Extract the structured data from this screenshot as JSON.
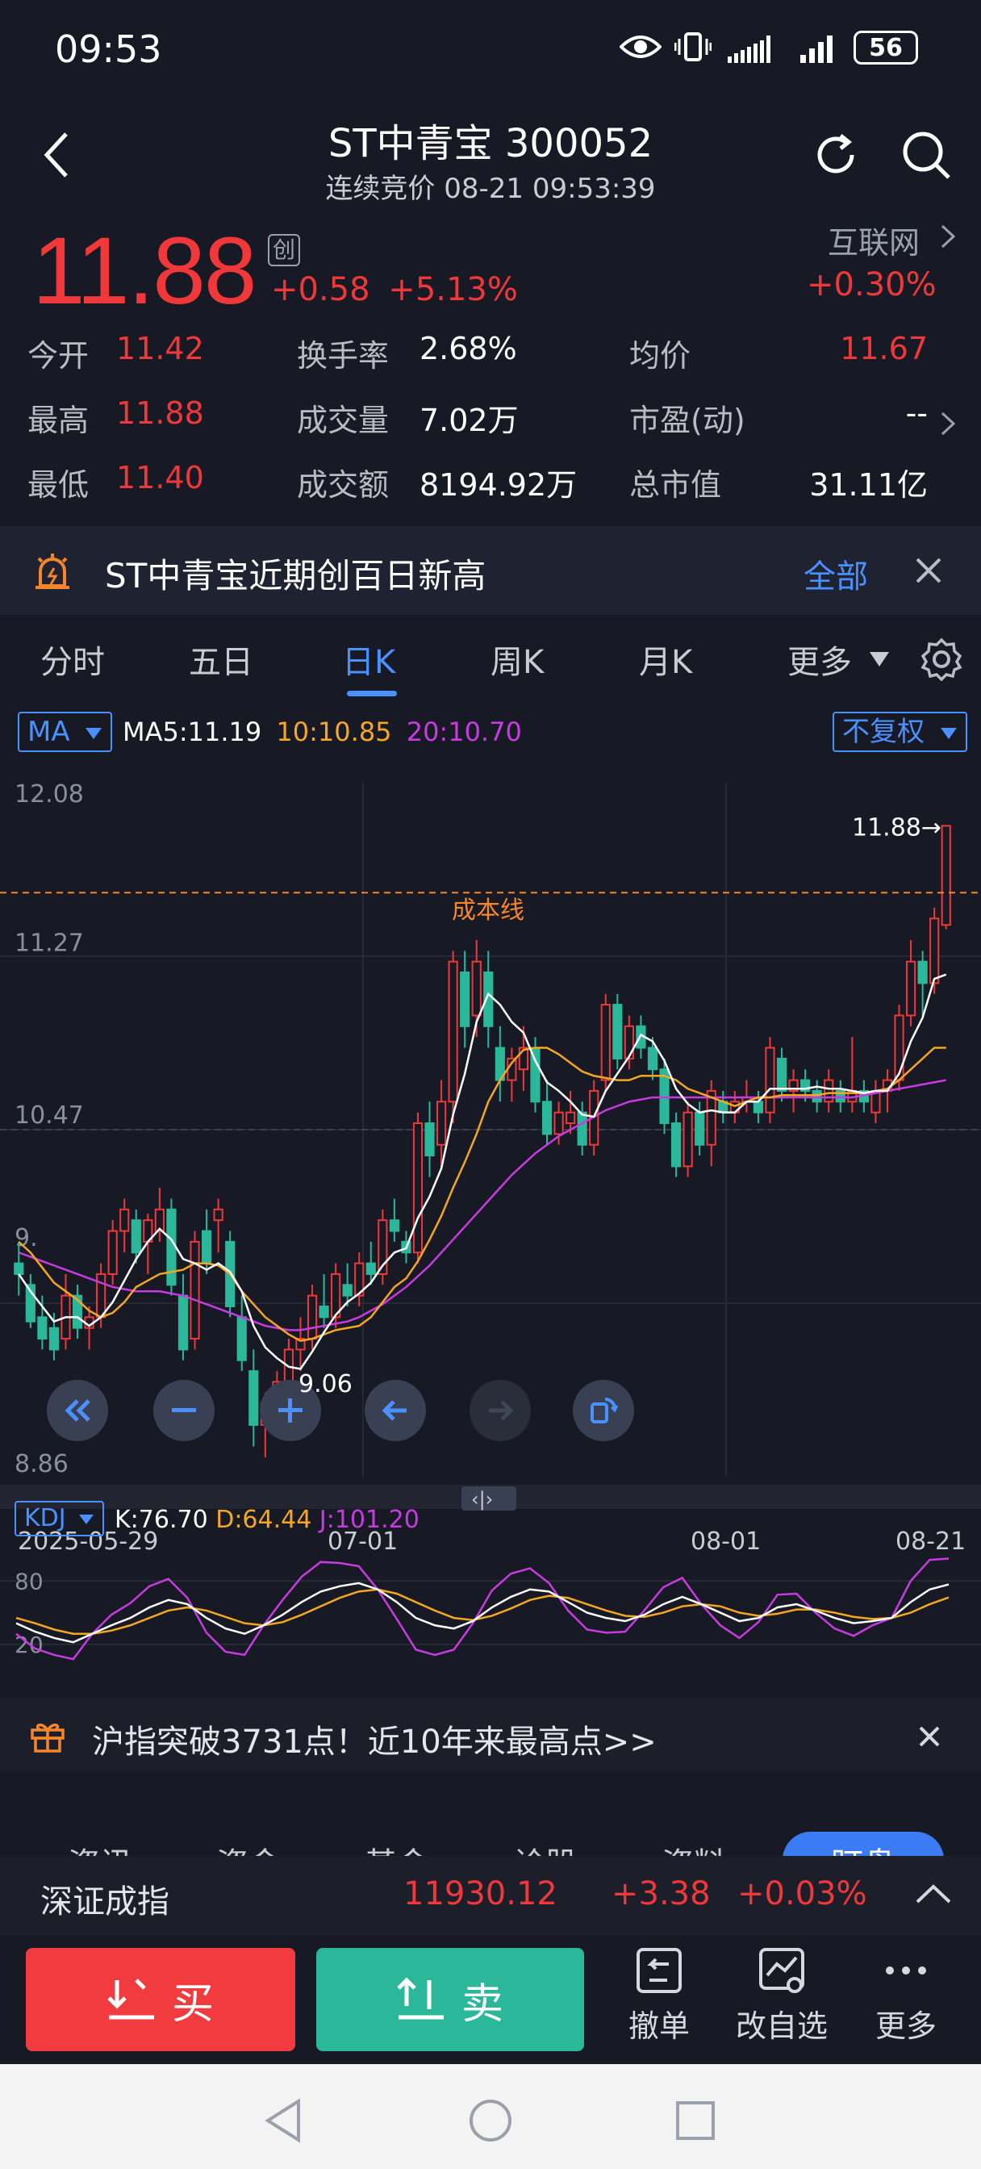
{
  "status": {
    "time": "09:53",
    "battery": "56"
  },
  "header": {
    "title": "ST中青宝 300052",
    "subtitle": "连续竞价 08-21 09:53:39"
  },
  "quote": {
    "price": "11.88",
    "board_badge": "创",
    "change": "+0.58",
    "change_pct": "+5.13%",
    "sector_name": "互联网",
    "sector_pct": "+0.30%",
    "stats": [
      {
        "label": "今开",
        "value": "11.42",
        "color": "red"
      },
      {
        "label": "换手率",
        "value": "2.68%",
        "color": "white"
      },
      {
        "label": "均价",
        "value": "11.67",
        "color": "red"
      },
      {
        "label": "最高",
        "value": "11.88",
        "color": "red"
      },
      {
        "label": "成交量",
        "value": "7.02万",
        "color": "white"
      },
      {
        "label": "市盈(动)",
        "value": "--",
        "color": "white"
      },
      {
        "label": "最低",
        "value": "11.40",
        "color": "red"
      },
      {
        "label": "成交额",
        "value": "8194.92万",
        "color": "white"
      },
      {
        "label": "总市值",
        "value": "31.11亿",
        "color": "white"
      }
    ]
  },
  "alert_banner": {
    "text": "ST中青宝近期创百日新高",
    "action": "全部"
  },
  "tabs": [
    {
      "label": "分时"
    },
    {
      "label": "五日"
    },
    {
      "label": "日K",
      "active": true
    },
    {
      "label": "周K"
    },
    {
      "label": "月K"
    },
    {
      "label": "更多"
    }
  ],
  "kline": {
    "indicator": "MA",
    "ma5": "MA5:11.19",
    "ma10": "10:10.85",
    "ma20": "20:10.70",
    "adjust": "不复权",
    "y_labels": [
      "12.08",
      "11.27",
      "10.47",
      "9.",
      "8.86"
    ],
    "cost_line_label": "成本线",
    "last_price_label": "11.88",
    "low_label": "9.06",
    "x_labels": [
      "2025-05-29",
      "07-01",
      "08-01",
      "08-21"
    ],
    "colors": {
      "up": "#f0383a",
      "down": "#2bb79a",
      "ma5": "#ffffff",
      "ma10": "#f5a623",
      "ma20": "#c73be0",
      "cost": "#f5862c"
    }
  },
  "kdj": {
    "indicator": "KDJ",
    "k": "K:76.70",
    "d": "D:64.44",
    "j": "J:101.20",
    "y_labels": [
      "80",
      "20"
    ]
  },
  "promo_banner": {
    "text": "沪指突破3731点！近10年来最高点>>"
  },
  "hidden_tabs": [
    "资讯",
    "资金",
    "基金",
    "诊股",
    "资料",
    "盯盘"
  ],
  "index": {
    "name": "深证成指",
    "value": "11930.12",
    "change": "+3.38",
    "pct": "+0.03%"
  },
  "actions": {
    "buy": "买",
    "sell": "卖",
    "cancel": "撤单",
    "edit_watch": "改自选",
    "more": "更多"
  },
  "chart_data": [
    {
      "type": "candlestick",
      "title": "",
      "x_labels": [
        "2025-05-29",
        "07-01",
        "08-01",
        "08-21"
      ],
      "ylim": [
        8.86,
        12.08
      ],
      "y_ticks": [
        12.08,
        11.27,
        10.47,
        8.86
      ],
      "candles": [
        [
          9.85,
          9.95,
          9.7,
          9.8
        ],
        [
          9.75,
          9.8,
          9.55,
          9.58
        ],
        [
          9.6,
          9.7,
          9.45,
          9.5
        ],
        [
          9.55,
          9.62,
          9.4,
          9.45
        ],
        [
          9.5,
          9.8,
          9.45,
          9.7
        ],
        [
          9.7,
          9.75,
          9.5,
          9.55
        ],
        [
          9.55,
          9.65,
          9.45,
          9.6
        ],
        [
          9.6,
          9.85,
          9.55,
          9.8
        ],
        [
          9.8,
          10.05,
          9.75,
          10.0
        ],
        [
          10.0,
          10.15,
          9.9,
          10.1
        ],
        [
          10.05,
          10.1,
          9.85,
          9.9
        ],
        [
          9.95,
          10.08,
          9.8,
          10.05
        ],
        [
          10.0,
          10.2,
          9.95,
          10.1
        ],
        [
          10.1,
          10.15,
          9.7,
          9.75
        ],
        [
          9.7,
          9.8,
          9.4,
          9.45
        ],
        [
          9.5,
          10.0,
          9.45,
          9.95
        ],
        [
          10.0,
          10.1,
          9.8,
          9.85
        ],
        [
          10.05,
          10.15,
          9.9,
          10.1
        ],
        [
          9.95,
          10.0,
          9.6,
          9.65
        ],
        [
          9.6,
          9.7,
          9.35,
          9.4
        ],
        [
          9.35,
          9.45,
          9.0,
          9.1
        ],
        [
          9.1,
          9.25,
          8.95,
          9.2
        ],
        [
          9.2,
          9.35,
          9.1,
          9.3
        ],
        [
          9.3,
          9.5,
          9.2,
          9.45
        ],
        [
          9.45,
          9.6,
          9.35,
          9.5
        ],
        [
          9.5,
          9.75,
          9.45,
          9.7
        ],
        [
          9.65,
          9.8,
          9.55,
          9.6
        ],
        [
          9.6,
          9.85,
          9.55,
          9.8
        ],
        [
          9.75,
          9.85,
          9.65,
          9.7
        ],
        [
          9.7,
          9.9,
          9.65,
          9.85
        ],
        [
          9.85,
          9.95,
          9.75,
          9.8
        ],
        [
          9.8,
          10.1,
          9.75,
          10.05
        ],
        [
          10.05,
          10.15,
          9.95,
          10.0
        ],
        [
          9.95,
          10.0,
          9.85,
          9.9
        ],
        [
          9.9,
          10.55,
          9.85,
          10.5
        ],
        [
          10.5,
          10.6,
          10.25,
          10.35
        ],
        [
          10.4,
          10.7,
          10.3,
          10.6
        ],
        [
          10.6,
          11.3,
          10.5,
          11.25
        ],
        [
          11.2,
          11.3,
          10.85,
          10.95
        ],
        [
          11.0,
          11.35,
          10.9,
          11.25
        ],
        [
          11.2,
          11.3,
          10.85,
          10.95
        ],
        [
          10.85,
          10.95,
          10.6,
          10.7
        ],
        [
          10.7,
          10.85,
          10.6,
          10.8
        ],
        [
          10.75,
          10.95,
          10.65,
          10.85
        ],
        [
          10.85,
          10.9,
          10.55,
          10.6
        ],
        [
          10.6,
          10.7,
          10.4,
          10.45
        ],
        [
          10.45,
          10.6,
          10.4,
          10.55
        ],
        [
          10.5,
          10.65,
          10.45,
          10.55
        ],
        [
          10.55,
          10.6,
          10.35,
          10.4
        ],
        [
          10.4,
          10.7,
          10.35,
          10.65
        ],
        [
          10.7,
          11.1,
          10.65,
          11.05
        ],
        [
          11.05,
          11.1,
          10.75,
          10.8
        ],
        [
          10.8,
          11.0,
          10.75,
          10.95
        ],
        [
          10.95,
          11.0,
          10.8,
          10.85
        ],
        [
          10.85,
          10.9,
          10.7,
          10.75
        ],
        [
          10.75,
          10.8,
          10.45,
          10.5
        ],
        [
          10.5,
          10.55,
          10.25,
          10.3
        ],
        [
          10.3,
          10.6,
          10.25,
          10.55
        ],
        [
          10.55,
          10.6,
          10.35,
          10.4
        ],
        [
          10.4,
          10.7,
          10.3,
          10.65
        ],
        [
          10.6,
          10.65,
          10.5,
          10.55
        ],
        [
          10.55,
          10.65,
          10.5,
          10.6
        ],
        [
          10.6,
          10.7,
          10.55,
          10.62
        ],
        [
          10.6,
          10.65,
          10.5,
          10.55
        ],
        [
          10.55,
          10.9,
          10.5,
          10.85
        ],
        [
          10.8,
          10.85,
          10.6,
          10.65
        ],
        [
          10.65,
          10.75,
          10.55,
          10.7
        ],
        [
          10.7,
          10.75,
          10.6,
          10.65
        ],
        [
          10.65,
          10.7,
          10.55,
          10.6
        ],
        [
          10.6,
          10.75,
          10.55,
          10.7
        ],
        [
          10.65,
          10.7,
          10.55,
          10.6
        ],
        [
          10.6,
          10.9,
          10.55,
          10.65
        ],
        [
          10.65,
          10.7,
          10.55,
          10.6
        ],
        [
          10.55,
          10.7,
          10.5,
          10.65
        ],
        [
          10.65,
          10.75,
          10.55,
          10.7
        ],
        [
          10.7,
          11.05,
          10.65,
          11.0
        ],
        [
          11.0,
          11.35,
          10.95,
          11.25
        ],
        [
          11.25,
          11.3,
          11.0,
          11.15
        ],
        [
          11.15,
          11.5,
          11.1,
          11.45
        ],
        [
          11.42,
          11.88,
          11.4,
          11.88
        ]
      ],
      "ma5_series": [
        9.8,
        9.72,
        9.65,
        9.58,
        9.6,
        9.6,
        9.56,
        9.6,
        9.67,
        9.77,
        9.87,
        9.95,
        10.01,
        9.96,
        9.87,
        9.85,
        9.82,
        9.85,
        9.81,
        9.72,
        9.56,
        9.46,
        9.41,
        9.37,
        9.36,
        9.44,
        9.53,
        9.61,
        9.67,
        9.71,
        9.76,
        9.84,
        9.9,
        9.92,
        10.06,
        10.16,
        10.29,
        10.54,
        10.73,
        10.97,
        11.1,
        11.05,
        10.97,
        10.92,
        10.79,
        10.69,
        10.65,
        10.6,
        10.54,
        10.53,
        10.65,
        10.73,
        10.81,
        10.91,
        10.88,
        10.79,
        10.66,
        10.59,
        10.55,
        10.56,
        10.55,
        10.55,
        10.6,
        10.6,
        10.66,
        10.66,
        10.66,
        10.66,
        10.67,
        10.66,
        10.66,
        10.65,
        10.64,
        10.65,
        10.65,
        10.73,
        10.88,
        10.99,
        11.17,
        11.19
      ],
      "ma10_series": [
        9.95,
        9.9,
        9.83,
        9.76,
        9.72,
        9.68,
        9.63,
        9.6,
        9.62,
        9.67,
        9.74,
        9.77,
        9.8,
        9.81,
        9.82,
        9.85,
        9.85,
        9.84,
        9.8,
        9.72,
        9.66,
        9.6,
        9.56,
        9.52,
        9.49,
        9.5,
        9.52,
        9.54,
        9.55,
        9.56,
        9.6,
        9.67,
        9.74,
        9.78,
        9.86,
        9.96,
        10.07,
        10.2,
        10.32,
        10.45,
        10.6,
        10.7,
        10.78,
        10.84,
        10.85,
        10.85,
        10.82,
        10.78,
        10.74,
        10.72,
        10.71,
        10.7,
        10.7,
        10.72,
        10.72,
        10.72,
        10.7,
        10.66,
        10.64,
        10.62,
        10.6,
        10.58,
        10.6,
        10.62,
        10.62,
        10.63,
        10.63,
        10.63,
        10.63,
        10.64,
        10.64,
        10.64,
        10.64,
        10.65,
        10.66,
        10.7,
        10.75,
        10.8,
        10.85,
        10.85
      ],
      "ma20_series": [
        9.9,
        9.88,
        9.86,
        9.84,
        9.82,
        9.8,
        9.78,
        9.76,
        9.74,
        9.73,
        9.72,
        9.72,
        9.72,
        9.71,
        9.7,
        9.68,
        9.66,
        9.64,
        9.62,
        9.6,
        9.58,
        9.56,
        9.55,
        9.54,
        9.54,
        9.55,
        9.56,
        9.57,
        9.58,
        9.6,
        9.63,
        9.66,
        9.7,
        9.74,
        9.79,
        9.84,
        9.9,
        9.96,
        10.02,
        10.08,
        10.14,
        10.2,
        10.26,
        10.31,
        10.36,
        10.4,
        10.44,
        10.47,
        10.5,
        10.53,
        10.56,
        10.58,
        10.6,
        10.61,
        10.62,
        10.62,
        10.62,
        10.62,
        10.62,
        10.62,
        10.62,
        10.62,
        10.62,
        10.62,
        10.62,
        10.62,
        10.62,
        10.62,
        10.62,
        10.62,
        10.62,
        10.62,
        10.63,
        10.64,
        10.65,
        10.66,
        10.67,
        10.68,
        10.69,
        10.7
      ],
      "cost_line": 11.57
    },
    {
      "type": "line",
      "title": "KDJ",
      "ylim": [
        0,
        110
      ],
      "series": [
        {
          "name": "K",
          "values": [
            40,
            32,
            26,
            22,
            30,
            38,
            45,
            55,
            62,
            58,
            45,
            35,
            30,
            38,
            48,
            60,
            70,
            75,
            78,
            72,
            60,
            45,
            38,
            35,
            42,
            55,
            65,
            72,
            70,
            60,
            50,
            45,
            42,
            48,
            58,
            65,
            58,
            50,
            42,
            45,
            55,
            58,
            52,
            45,
            40,
            42,
            45,
            60,
            72,
            76.7
          ]
        },
        {
          "name": "D",
          "values": [
            45,
            40,
            34,
            30,
            30,
            33,
            38,
            45,
            52,
            55,
            52,
            46,
            40,
            38,
            41,
            48,
            56,
            64,
            70,
            72,
            68,
            60,
            52,
            45,
            43,
            47,
            54,
            62,
            66,
            64,
            58,
            52,
            47,
            46,
            50,
            56,
            58,
            56,
            50,
            47,
            49,
            53,
            53,
            50,
            46,
            44,
            45,
            50,
            58,
            64.44
          ]
        },
        {
          "name": "J",
          "values": [
            30,
            16,
            10,
            6,
            30,
            48,
            59,
            75,
            82,
            64,
            31,
            13,
            10,
            38,
            62,
            84,
            98,
            97,
            94,
            72,
            44,
            15,
            10,
            15,
            40,
            71,
            87,
            92,
            78,
            52,
            34,
            31,
            32,
            52,
            74,
            83,
            58,
            38,
            26,
            41,
            67,
            68,
            50,
            35,
            28,
            38,
            45,
            80,
            100,
            101.2
          ]
        }
      ]
    }
  ]
}
